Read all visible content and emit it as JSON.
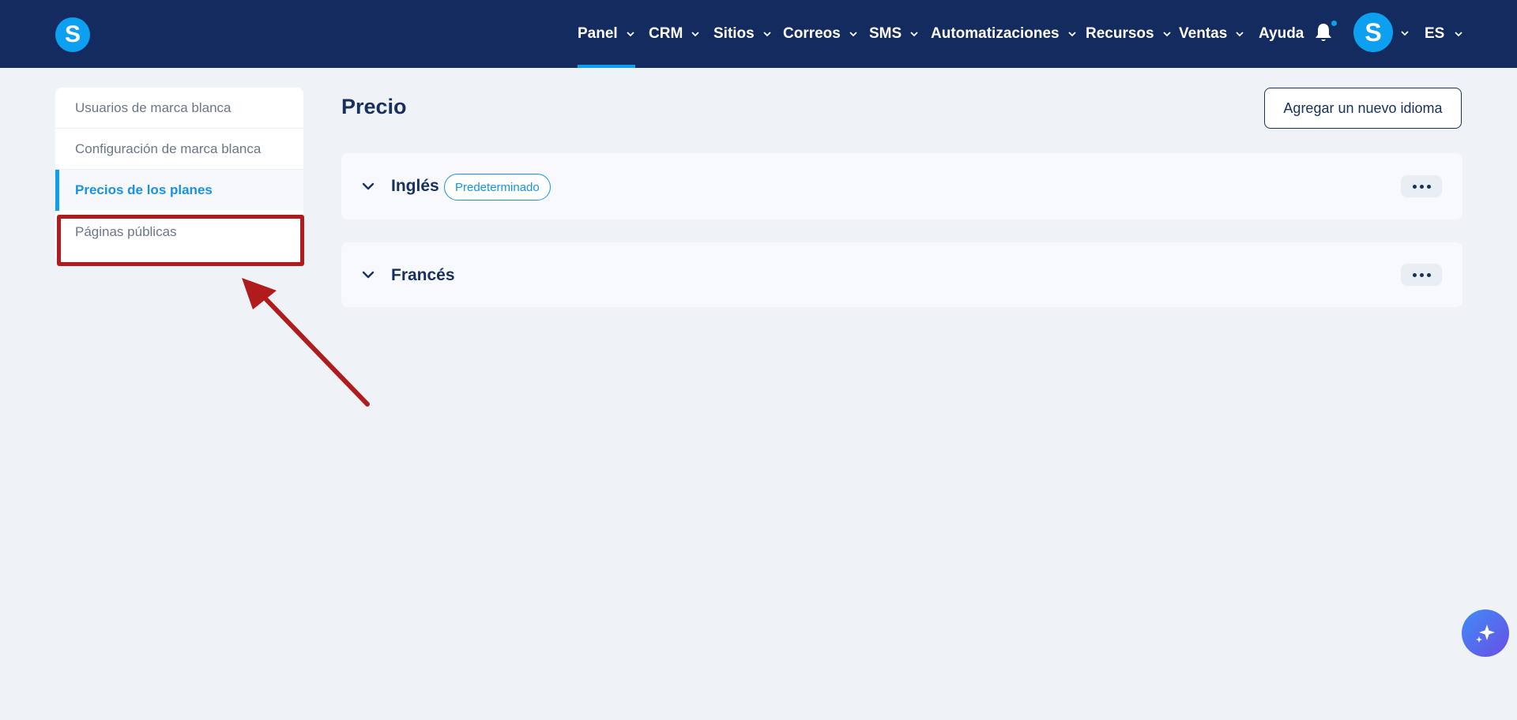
{
  "nav": {
    "items": [
      {
        "label": "Panel",
        "has_dropdown": true,
        "active": true
      },
      {
        "label": "CRM",
        "has_dropdown": true
      },
      {
        "label": "Sitios",
        "has_dropdown": true
      },
      {
        "label": "Correos",
        "has_dropdown": true
      },
      {
        "label": "SMS",
        "has_dropdown": true
      },
      {
        "label": "Automatizaciones",
        "has_dropdown": true
      },
      {
        "label": "Recursos",
        "has_dropdown": true
      },
      {
        "label": "Ventas",
        "has_dropdown": true
      },
      {
        "label": "Ayuda",
        "has_dropdown": false
      }
    ],
    "logo_letter": "S",
    "avatar_letter": "S",
    "language": "ES",
    "notification_icon": "bell-icon"
  },
  "sidebar": {
    "items": [
      {
        "label": "Usuarios de marca blanca"
      },
      {
        "label": "Configuración de marca blanca"
      },
      {
        "label": "Precios de los planes",
        "active": true
      },
      {
        "label": "Páginas públicas",
        "highlighted": true
      }
    ]
  },
  "main": {
    "title": "Precio",
    "add_language_label": "Agregar un nuevo idioma",
    "languages": [
      {
        "name": "Inglés",
        "badge": "Predeterminado"
      },
      {
        "name": "Francés"
      }
    ]
  },
  "colors": {
    "topbar": "#132b5e",
    "accent": "#0ea0f0",
    "annotation": "#b01c1c",
    "background": "#eff3f8"
  }
}
